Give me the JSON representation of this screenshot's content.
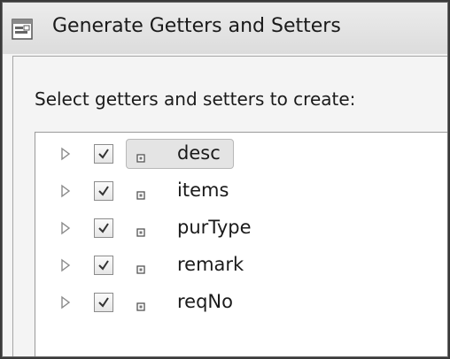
{
  "window": {
    "title": "Generate Getters and Setters"
  },
  "instruction": "Select getters and setters to create:",
  "fields": [
    {
      "name": "desc",
      "checked": true,
      "selected": true
    },
    {
      "name": "items",
      "checked": true,
      "selected": false
    },
    {
      "name": "purType",
      "checked": true,
      "selected": false
    },
    {
      "name": "remark",
      "checked": true,
      "selected": false
    },
    {
      "name": "reqNo",
      "checked": true,
      "selected": false
    }
  ],
  "icons": {
    "title": "dialog-icon",
    "expander": "expand-arrow-icon",
    "field": "field-icon",
    "checkmark": "checkmark-icon"
  }
}
